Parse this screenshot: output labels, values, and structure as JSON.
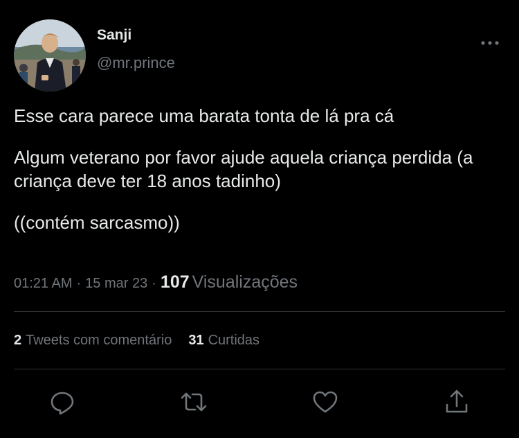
{
  "user": {
    "display_name": "Sanji",
    "handle": "@mr.prince",
    "avatar_icon": "profile-photo"
  },
  "tweet": {
    "lines": [
      "Esse cara parece uma barata tonta de lá pra cá",
      "Algum veterano por favor ajude aquela criança perdida (a criança deve ter 18 anos tadinho)",
      "((contém sarcasmo))"
    ],
    "time": "01:21 AM",
    "date": "15 mar 23",
    "separator": "·",
    "views_count": "107",
    "views_label": "Visualizações"
  },
  "stats": {
    "quotes_count": "2",
    "quotes_label": "Tweets com comentário",
    "likes_count": "31",
    "likes_label": "Curtidas"
  },
  "actions": [
    "reply-icon",
    "retweet-icon",
    "like-icon",
    "share-icon"
  ],
  "colors": {
    "background": "#000000",
    "text_primary": "#e7e9ea",
    "text_secondary": "#71767b",
    "divider": "#2f3336",
    "icon": "#71767b"
  }
}
